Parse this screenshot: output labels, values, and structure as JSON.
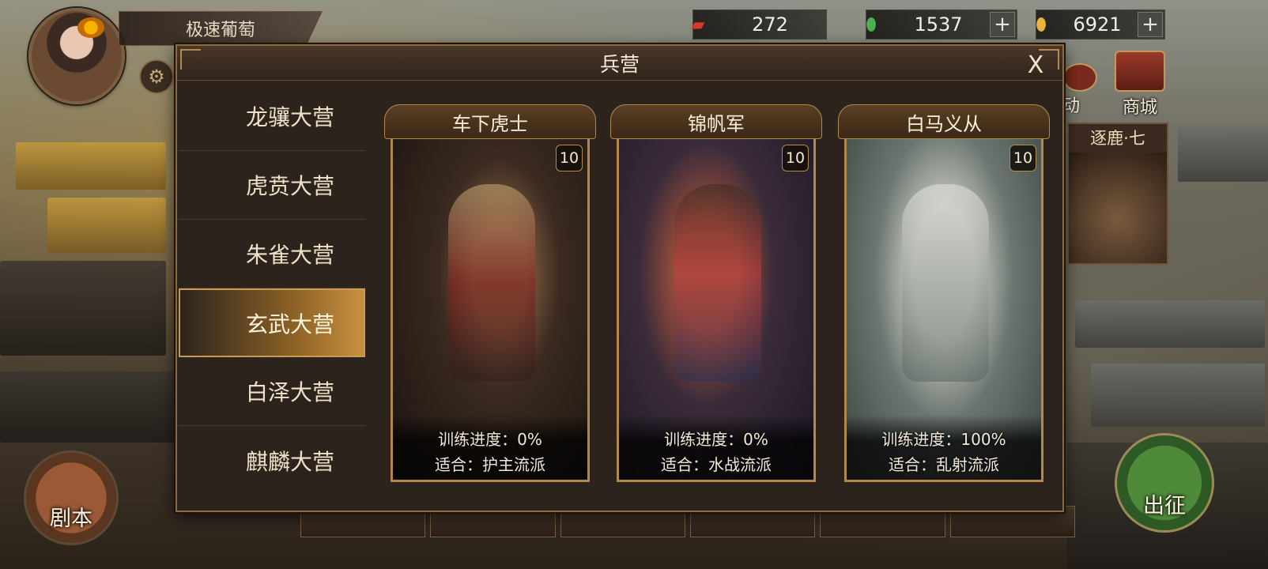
{
  "player": {
    "name": "极速葡萄"
  },
  "resources": [
    {
      "icon": "token-card-icon",
      "value": "272"
    },
    {
      "icon": "jade-icon",
      "value": "1537",
      "plus": "+"
    },
    {
      "icon": "gold-ingot-icon",
      "value": "6921",
      "plus": "+"
    }
  ],
  "hud": {
    "shop_label": "商城",
    "event_label": "动",
    "stage_label": "逐鹿·七",
    "script_label": "剧本",
    "march_label": "出征"
  },
  "modal": {
    "title": "兵营",
    "close_label": "X",
    "nav": [
      {
        "label": "龙骧大营",
        "active": false
      },
      {
        "label": "虎贲大营",
        "active": false
      },
      {
        "label": "朱雀大营",
        "active": false
      },
      {
        "label": "玄武大营",
        "active": true
      },
      {
        "label": "白泽大营",
        "active": false
      },
      {
        "label": "麒麟大营",
        "active": false
      }
    ],
    "units": [
      {
        "name": "车下虎士",
        "level": "10",
        "progress_label": "训练进度：0%",
        "fit_label": "适合：护主流派"
      },
      {
        "name": "锦帆军",
        "level": "10",
        "progress_label": "训练进度：0%",
        "fit_label": "适合：水战流派"
      },
      {
        "name": "白马义从",
        "level": "10",
        "progress_label": "训练进度：100%",
        "fit_label": "适合：乱射流派"
      }
    ]
  }
}
